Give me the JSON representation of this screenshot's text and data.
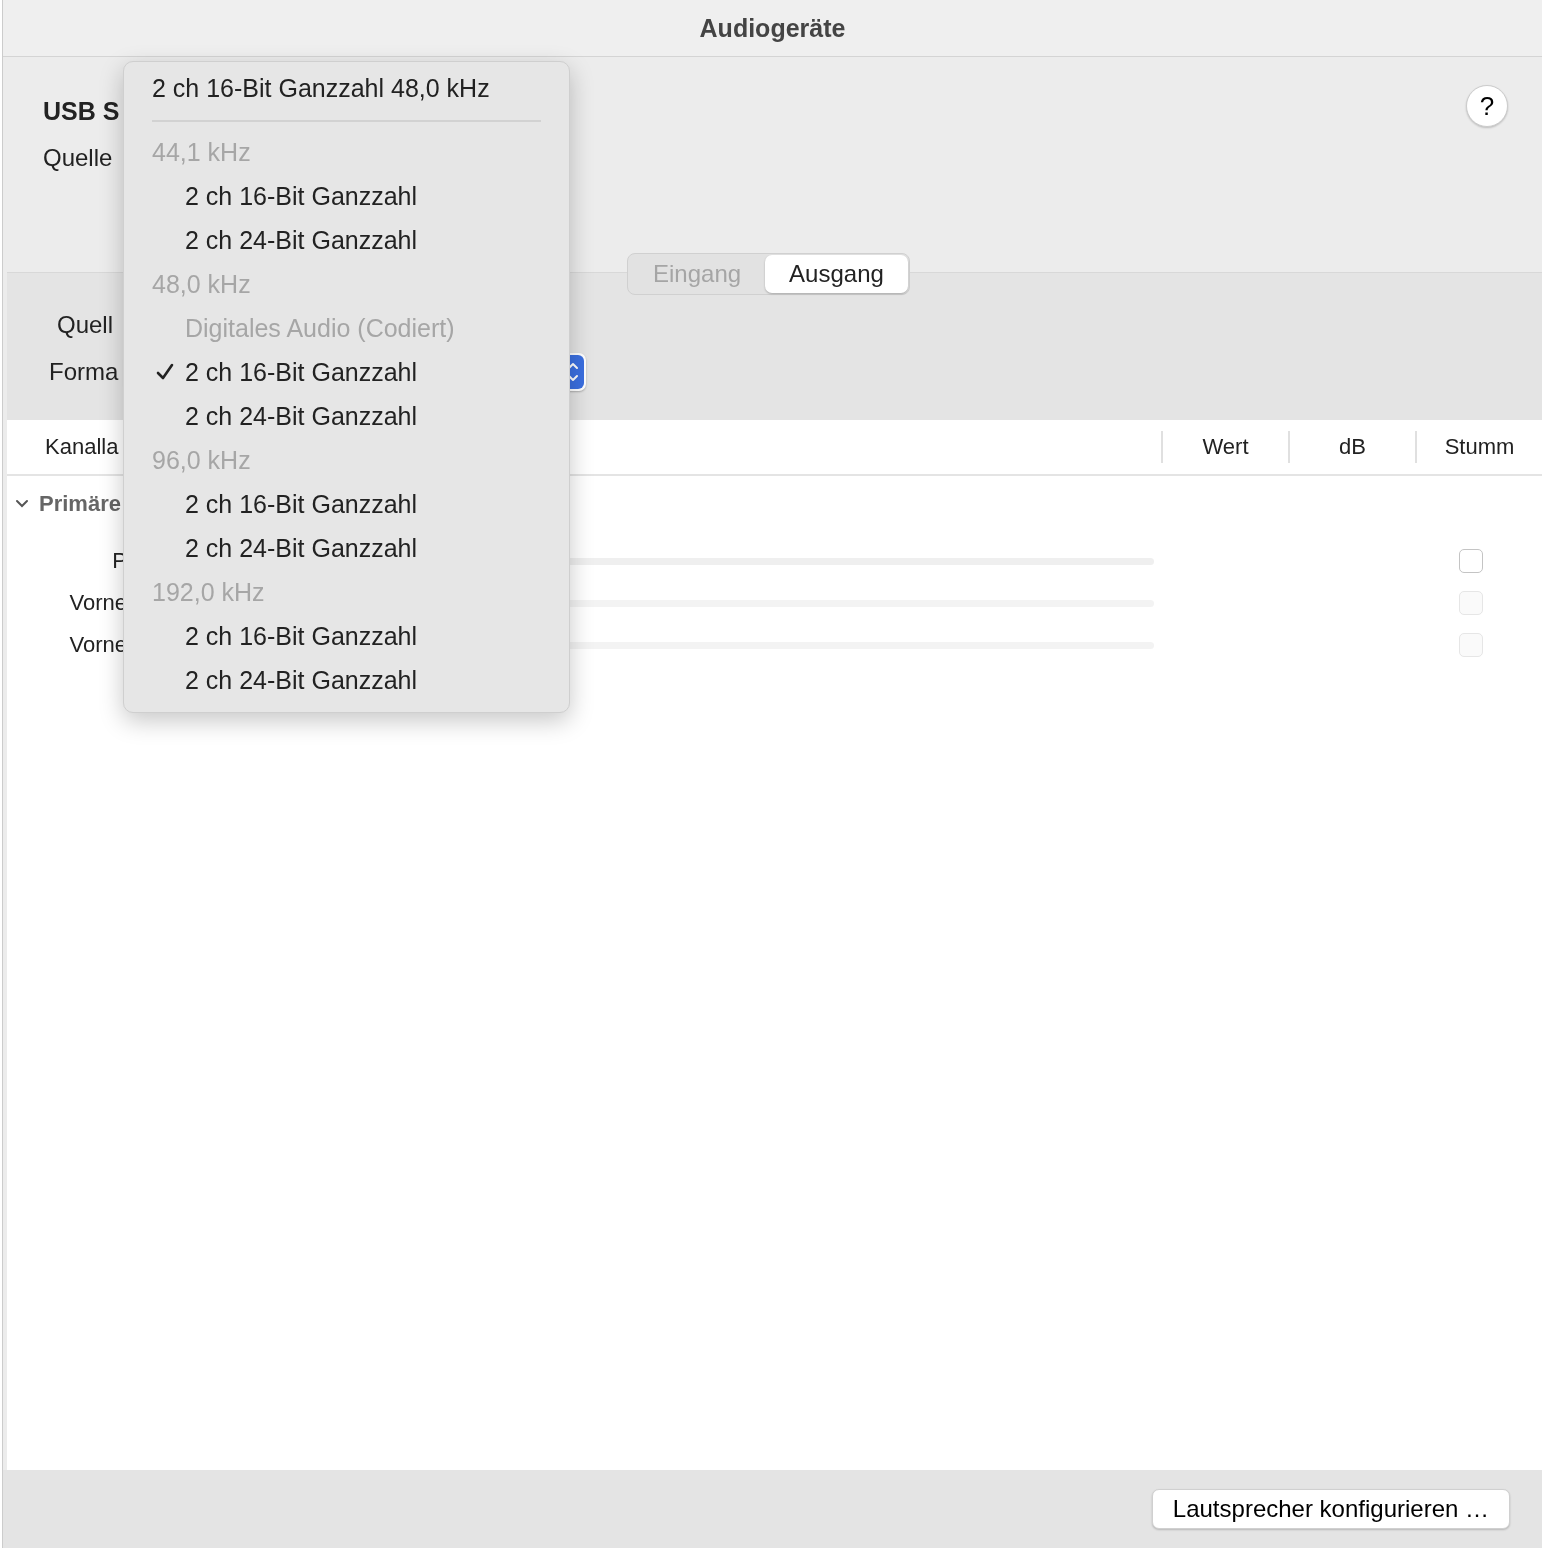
{
  "window": {
    "title": "Audiogeräte"
  },
  "device": {
    "name": "USB S",
    "source_label": "Quelle"
  },
  "help": {
    "label": "?"
  },
  "tabs": [
    {
      "label": "Eingang",
      "selected": false
    },
    {
      "label": "Ausgang",
      "selected": true
    }
  ],
  "output": {
    "source_label": "Quell",
    "format_label": "Forma"
  },
  "table": {
    "columns": [
      "Kanalla",
      "Wert",
      "dB",
      "Stumm"
    ],
    "group": {
      "label": "Primäre",
      "expanded": true
    },
    "rows": [
      {
        "label": "P",
        "level": 0,
        "muted": false,
        "disabled": false
      },
      {
        "label": "Vorne",
        "level": 0,
        "muted": false,
        "disabled": true
      },
      {
        "label": "Vorne",
        "level": 0,
        "muted": false,
        "disabled": true
      }
    ]
  },
  "format_menu": {
    "current": "2 ch 16-Bit Ganzzahl 48,0 kHz",
    "items": [
      {
        "kind": "header",
        "label": "44,1 kHz"
      },
      {
        "kind": "option",
        "label": "2 ch 16-Bit Ganzzahl",
        "selected": false,
        "disabled": false
      },
      {
        "kind": "option",
        "label": "2 ch 24-Bit Ganzzahl",
        "selected": false,
        "disabled": false
      },
      {
        "kind": "header",
        "label": "48,0 kHz"
      },
      {
        "kind": "option",
        "label": "Digitales Audio (Codiert)",
        "selected": false,
        "disabled": true
      },
      {
        "kind": "option",
        "label": "2 ch 16-Bit Ganzzahl",
        "selected": true,
        "disabled": false
      },
      {
        "kind": "option",
        "label": "2 ch 24-Bit Ganzzahl",
        "selected": false,
        "disabled": false
      },
      {
        "kind": "header",
        "label": "96,0 kHz"
      },
      {
        "kind": "option",
        "label": "2 ch 16-Bit Ganzzahl",
        "selected": false,
        "disabled": false
      },
      {
        "kind": "option",
        "label": "2 ch 24-Bit Ganzzahl",
        "selected": false,
        "disabled": false
      },
      {
        "kind": "header",
        "label": "192,0 kHz"
      },
      {
        "kind": "option",
        "label": "2 ch 16-Bit Ganzzahl",
        "selected": false,
        "disabled": false
      },
      {
        "kind": "option",
        "label": "2 ch 24-Bit Ganzzahl",
        "selected": false,
        "disabled": false
      }
    ]
  },
  "footer": {
    "button": "Lautsprecher konfigurieren …"
  }
}
